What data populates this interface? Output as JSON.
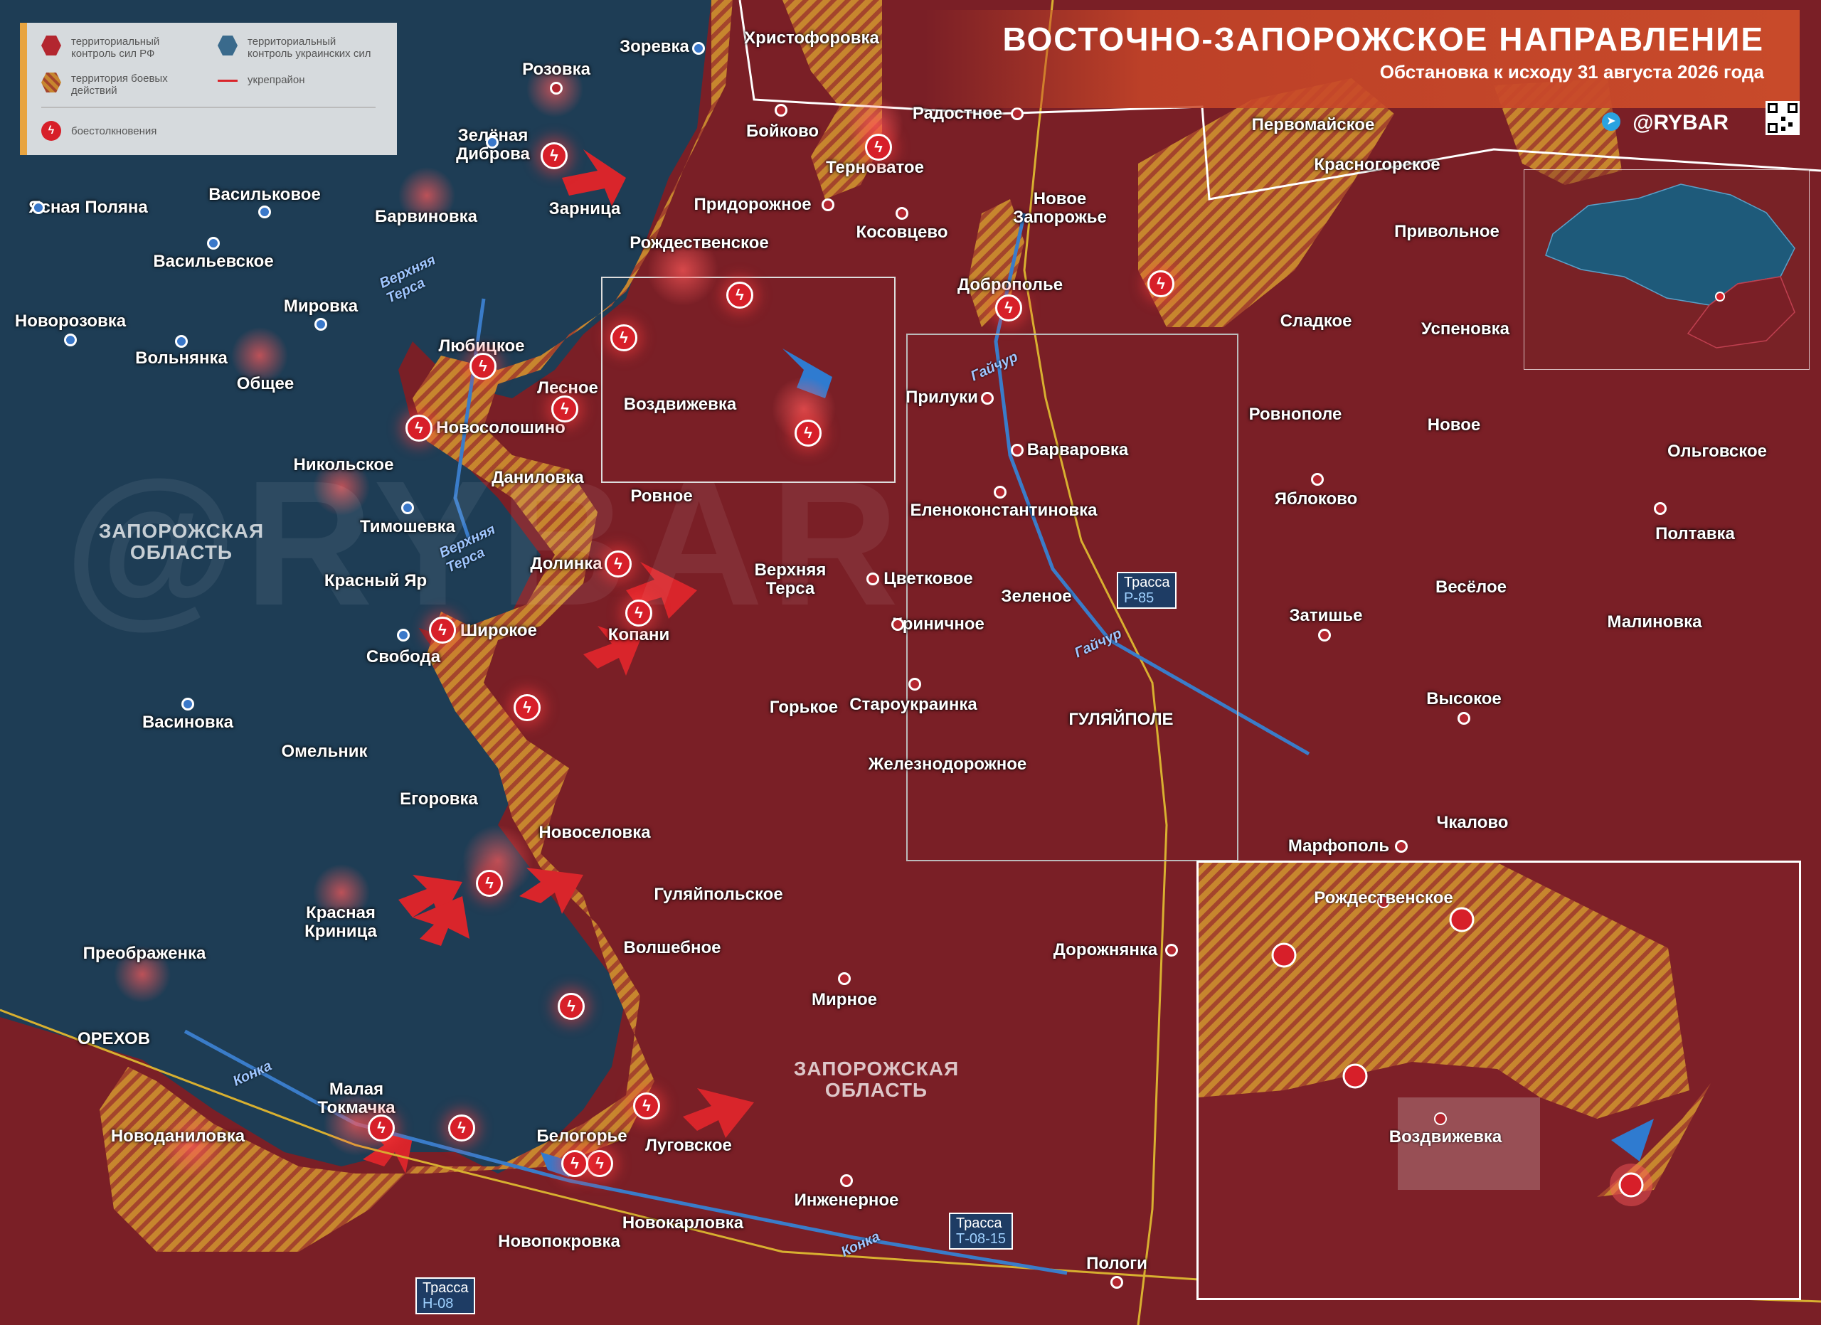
{
  "header": {
    "title": "ВОСТОЧНО-ЗАПОРОЖСКОЕ НАПРАВЛЕНИЕ",
    "subtitle": "Обстановка к исходу 31 августа 2026 года",
    "brand": "@RYBAR"
  },
  "legend": {
    "ru_control": "территориальный контроль сил РФ",
    "ua_control": "территориальный контроль украинских сил",
    "combat_zone": "территория боевых действий",
    "fortified": "укрепрайон",
    "clashes": "боестолкновения"
  },
  "colors": {
    "ru": "#7a1f26",
    "ua": "#1e3d55",
    "contested": "#c9842c",
    "clash": "#d71f29",
    "ua_marker": "#3a78c9",
    "arrow_red": "#d9252b",
    "arrow_blue": "#2f7bd0"
  },
  "places": [
    {
      "id": "rozovka",
      "name": "Розовка",
      "side": "ru"
    },
    {
      "id": "zorevka",
      "name": "Зоревка",
      "side": "ua"
    },
    {
      "id": "hristoforovka",
      "name": "Христофоровка",
      "side": "ru"
    },
    {
      "id": "radostnoe",
      "name": "Радостное",
      "side": "ru"
    },
    {
      "id": "boykovo",
      "name": "Бойково",
      "side": "ru"
    },
    {
      "id": "ternovatoe",
      "name": "Терноватое",
      "side": "ru"
    },
    {
      "id": "zelenaya_dibrova",
      "name": "Зелёная",
      "name2": "Диброва",
      "side": "ua"
    },
    {
      "id": "zarnitsa",
      "name": "Зарница",
      "side": "ru"
    },
    {
      "id": "yasnaya_polyana",
      "name": "Ясная Поляна",
      "side": "ua"
    },
    {
      "id": "vasilkovoe",
      "name": "Васильковое",
      "side": "ua"
    },
    {
      "id": "barvinovka",
      "name": "Барвиновка",
      "side": "ru"
    },
    {
      "id": "pridorozhnoe",
      "name": "Придорожное",
      "side": "ru"
    },
    {
      "id": "kosovtsevo",
      "name": "Косовцево",
      "side": "ru"
    },
    {
      "id": "novoe_zaporozhe",
      "name": "Новое",
      "name2": "Запорожье",
      "side": "ru"
    },
    {
      "id": "pervomayskoe",
      "name": "Первомайское",
      "side": "ru"
    },
    {
      "id": "krasnogorskoe",
      "name": "Красногорское",
      "side": "ru"
    },
    {
      "id": "privolnoe",
      "name": "Привольное",
      "side": "ru"
    },
    {
      "id": "vasilevskoe",
      "name": "Васильевское",
      "side": "ua"
    },
    {
      "id": "rozhdestvenskoe",
      "name": "Рождественское",
      "side": "ru"
    },
    {
      "id": "dobropole",
      "name": "Доброполье",
      "side": "ru"
    },
    {
      "id": "novorozovka",
      "name": "Новорозовка",
      "side": "ua"
    },
    {
      "id": "mirovka",
      "name": "Мировка",
      "side": "ua"
    },
    {
      "id": "sladkoe",
      "name": "Сладкое",
      "side": "ru"
    },
    {
      "id": "uspenovka",
      "name": "Успеновка",
      "side": "ru"
    },
    {
      "id": "volnyanka",
      "name": "Вольнянка",
      "side": "ua"
    },
    {
      "id": "lyubitskoe",
      "name": "Любицкое",
      "side": "ru"
    },
    {
      "id": "obschee",
      "name": "Общее",
      "side": "ru"
    },
    {
      "id": "lesnoe",
      "name": "Лесное",
      "side": "ru"
    },
    {
      "id": "vozdvizhevka",
      "name": "Воздвижевка",
      "side": "ru"
    },
    {
      "id": "priluki",
      "name": "Прилуки",
      "side": "ru"
    },
    {
      "id": "novosoloshino",
      "name": "Новосолошино",
      "side": "ru"
    },
    {
      "id": "rovnopole",
      "name": "Ровнополе",
      "side": "ru"
    },
    {
      "id": "novoe",
      "name": "Новое",
      "side": "ru"
    },
    {
      "id": "olgovskoe",
      "name": "Ольговское",
      "side": "ru"
    },
    {
      "id": "varvarovka",
      "name": "Варваровка",
      "side": "ru"
    },
    {
      "id": "nikolskoe",
      "name": "Никольское",
      "side": "ru"
    },
    {
      "id": "danilovka",
      "name": "Даниловка",
      "side": "ua"
    },
    {
      "id": "rovnoe",
      "name": "Ровное",
      "side": "ru"
    },
    {
      "id": "yablokovo",
      "name": "Яблоково",
      "side": "ru"
    },
    {
      "id": "elenokonstantinovka",
      "name": "Еленоконстантиновка",
      "side": "ru"
    },
    {
      "id": "timoshevka",
      "name": "Тимошевка",
      "side": "ua"
    },
    {
      "id": "poltavka",
      "name": "Полтавка",
      "side": "ru"
    },
    {
      "id": "dolinka",
      "name": "Долинка",
      "side": "ru"
    },
    {
      "id": "verhnyaya_tersa",
      "name": "Верхняя",
      "name2": "Терса",
      "side": "ru"
    },
    {
      "id": "tsvetkovoe",
      "name": "Цветковое",
      "side": "ru"
    },
    {
      "id": "krasny_yar",
      "name": "Красный Яр",
      "side": "ru"
    },
    {
      "id": "zelenoe",
      "name": "Зеленое",
      "side": "ru"
    },
    {
      "id": "veseloe",
      "name": "Весёлое",
      "side": "ru"
    },
    {
      "id": "shirokoe",
      "name": "Широкое",
      "side": "ru"
    },
    {
      "id": "kopani",
      "name": "Копани",
      "side": "ru"
    },
    {
      "id": "krinichnoe",
      "name": "Криничное",
      "side": "ru"
    },
    {
      "id": "zatishe",
      "name": "Затишье",
      "side": "ru"
    },
    {
      "id": "malinovka",
      "name": "Малиновка",
      "side": "ru"
    },
    {
      "id": "svoboda",
      "name": "Свобода",
      "side": "ua"
    },
    {
      "id": "vasinovka",
      "name": "Васиновка",
      "side": "ua"
    },
    {
      "id": "gorkoe",
      "name": "Горькое",
      "side": "ru"
    },
    {
      "id": "staroukrainka",
      "name": "Староукраинка",
      "side": "ru"
    },
    {
      "id": "gulyaypole",
      "name": "ГУЛЯЙПОЛЕ",
      "side": "ru"
    },
    {
      "id": "vysokoe",
      "name": "Высокое",
      "side": "ru"
    },
    {
      "id": "omelnik",
      "name": "Омельник",
      "side": "ua"
    },
    {
      "id": "zheleznodorozhnoe",
      "name": "Железнодорожное",
      "side": "ru"
    },
    {
      "id": "egorovka",
      "name": "Егоровка",
      "side": "ua"
    },
    {
      "id": "chkalovo",
      "name": "Чкалово",
      "side": "ru"
    },
    {
      "id": "novoselovka",
      "name": "Новоселовка",
      "side": "ru"
    },
    {
      "id": "marfopol",
      "name": "Марфополь",
      "side": "ru"
    },
    {
      "id": "gulyaypolskoe",
      "name": "Гуляйпольское",
      "side": "ru"
    },
    {
      "id": "krasnaya_krinitsa",
      "name": "Красная",
      "name2": "Криница",
      "side": "ru"
    },
    {
      "id": "preobrazhenka",
      "name": "Преображенка",
      "side": "ru"
    },
    {
      "id": "volshebnoe",
      "name": "Волшебное",
      "side": "ru"
    },
    {
      "id": "dorozhnyanka",
      "name": "Дорожнянка",
      "side": "ru"
    },
    {
      "id": "mirnoe",
      "name": "Мирное",
      "side": "ru"
    },
    {
      "id": "orekhov",
      "name": "ОРЕХОВ",
      "side": "ua"
    },
    {
      "id": "malaya_tokmachka",
      "name": "Малая",
      "name2": "Токмачка",
      "side": "ua"
    },
    {
      "id": "novodanilovka",
      "name": "Новоданиловка",
      "side": "ru"
    },
    {
      "id": "belogore",
      "name": "Белогорье",
      "side": "ua"
    },
    {
      "id": "lugovskoe",
      "name": "Луговское",
      "side": "ru"
    },
    {
      "id": "inzhenernoe",
      "name": "Инженерное",
      "side": "ru"
    },
    {
      "id": "novokarlovka",
      "name": "Новокарловка",
      "side": "ru"
    },
    {
      "id": "novopokrovka",
      "name": "Новопокровка",
      "side": "ru"
    },
    {
      "id": "pologi",
      "name": "Пологи",
      "side": "ru"
    }
  ],
  "regions": [
    {
      "id": "zap_obl_west",
      "name": "ЗАПОРОЖСКАЯ",
      "name2": "ОБЛАСТЬ"
    },
    {
      "id": "zap_obl_south",
      "name": "ЗАПОРОЖСКАЯ",
      "name2": "ОБЛАСТЬ"
    }
  ],
  "rivers": [
    {
      "id": "vt1",
      "name": "Верхняя",
      "name2": "Терса"
    },
    {
      "id": "vt2",
      "name": "Верхняя",
      "name2": "Терса"
    },
    {
      "id": "gaychur1",
      "name": "Гайчур"
    },
    {
      "id": "gaychur2",
      "name": "Гайчур"
    },
    {
      "id": "konka1",
      "name": "Конка"
    },
    {
      "id": "konka2",
      "name": "Конка"
    }
  ],
  "highways": [
    {
      "id": "r85",
      "label": "Трасса",
      "code": "Р-85"
    },
    {
      "id": "t0815",
      "label": "Трасса",
      "code": "Т-08-15"
    },
    {
      "id": "n08",
      "label": "Трасса",
      "code": "Н-08"
    }
  ],
  "zoom_inset": {
    "places": [
      {
        "id": "z_rozhd",
        "name": "Рождественское"
      },
      {
        "id": "z_vozd",
        "name": "Воздвижевка"
      }
    ]
  }
}
